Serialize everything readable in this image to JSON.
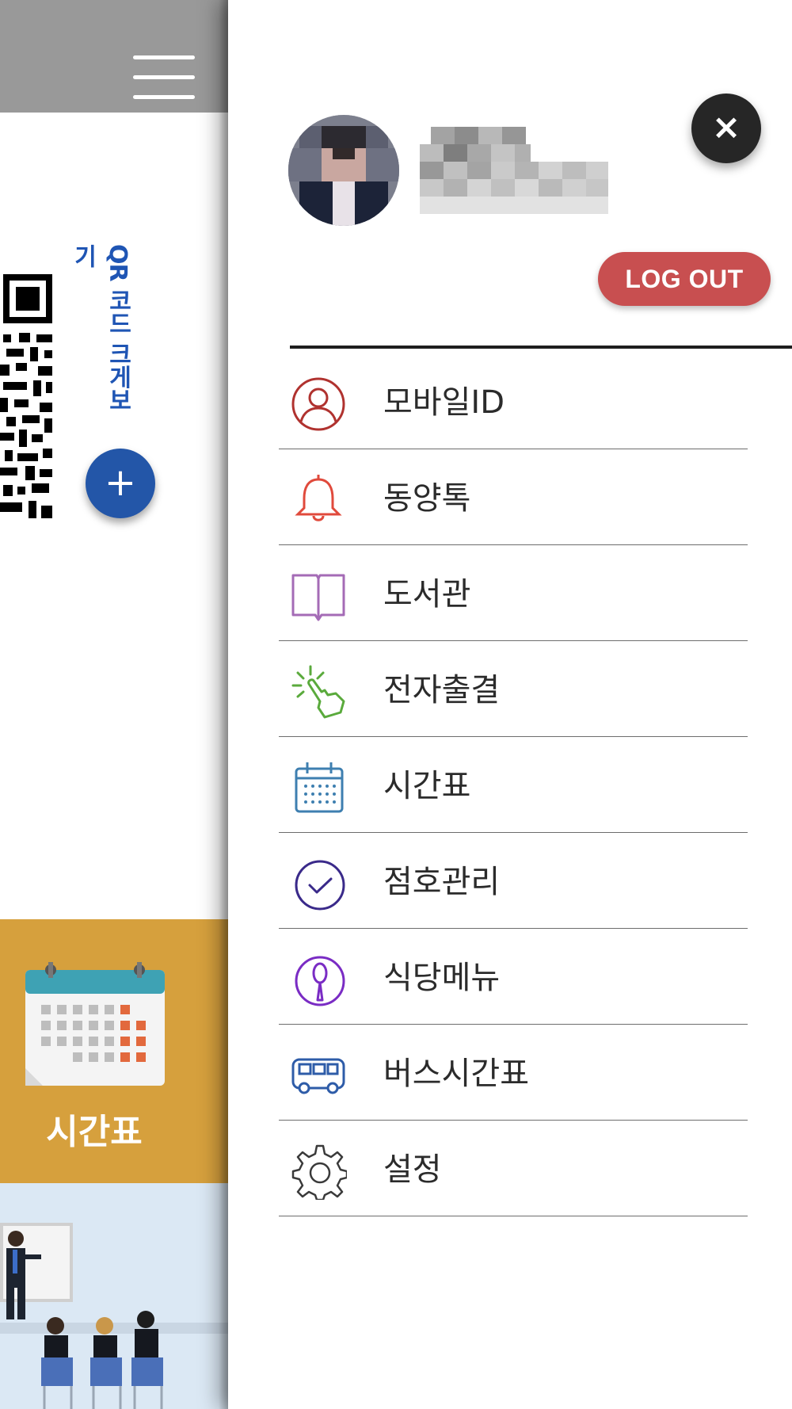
{
  "background_app": {
    "qr_enlarge_label": "QR 코드 크게보기",
    "qr_plus_symbol": "+",
    "timetable_tile_label": "시간표"
  },
  "drawer": {
    "close_symbol": "×",
    "logout_label": "LOG OUT",
    "menu": [
      {
        "label": "모바일ID",
        "icon": "user-circle-icon",
        "color": "#b0322f"
      },
      {
        "label": "동양톡",
        "icon": "bell-icon",
        "color": "#e04a3c"
      },
      {
        "label": "도서관",
        "icon": "book-icon",
        "color": "#a46bb6"
      },
      {
        "label": "전자출결",
        "icon": "tap-hand-icon",
        "color": "#5aaa3c"
      },
      {
        "label": "시간표",
        "icon": "calendar-icon",
        "color": "#3e7fb0"
      },
      {
        "label": "점호관리",
        "icon": "check-circle-icon",
        "color": "#3a2a8a"
      },
      {
        "label": "식당메뉴",
        "icon": "spoon-icon",
        "color": "#7a2cc4"
      },
      {
        "label": "버스시간표",
        "icon": "bus-icon",
        "color": "#2e5ca8"
      },
      {
        "label": "설정",
        "icon": "gear-icon",
        "color": "#3a3a3a"
      }
    ]
  }
}
